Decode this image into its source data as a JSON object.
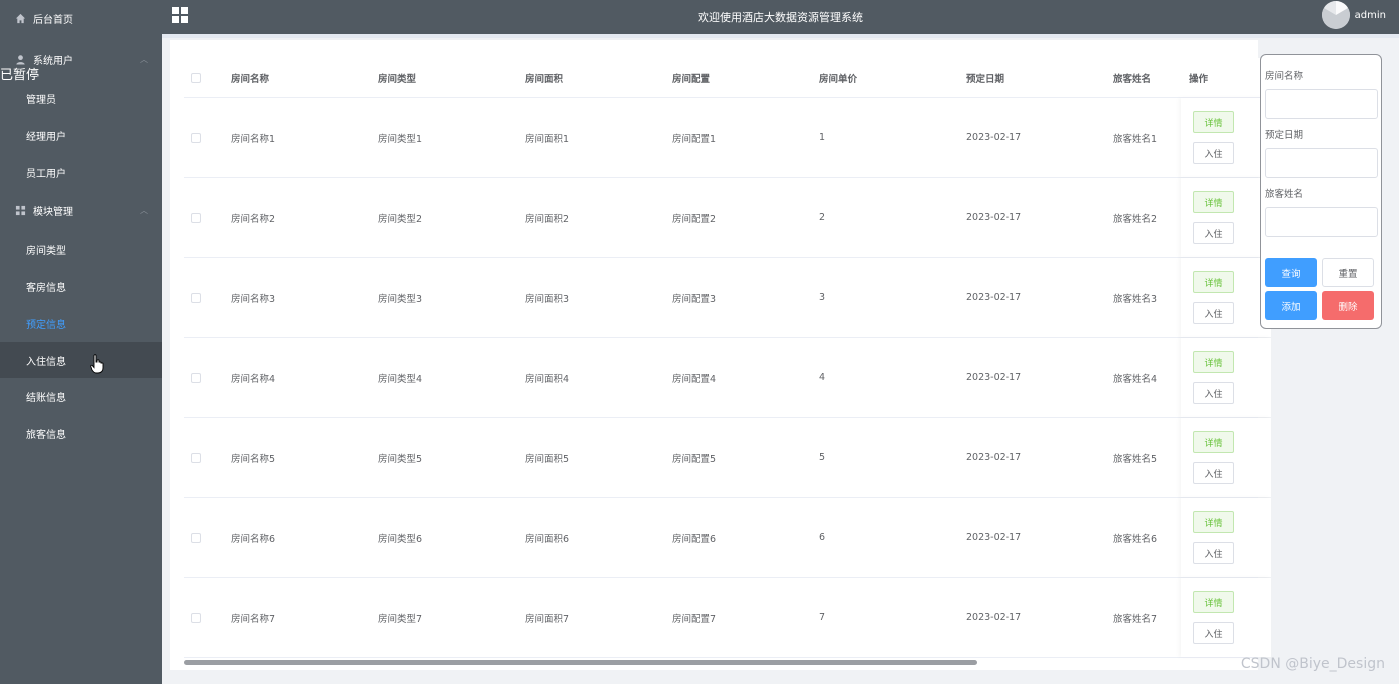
{
  "sidebar": {
    "paused_overlay": "已暂停",
    "items": [
      {
        "label": "后台首页",
        "icon": "home-icon"
      },
      {
        "label": "系统用户",
        "icon": "user-icon"
      },
      {
        "label": "管理员"
      },
      {
        "label": "经理用户"
      },
      {
        "label": "员工用户"
      },
      {
        "label": "模块管理",
        "icon": "grid-icon"
      },
      {
        "label": "房间类型"
      },
      {
        "label": "客房信息"
      },
      {
        "label": "预定信息"
      },
      {
        "label": "入住信息"
      },
      {
        "label": "结账信息"
      },
      {
        "label": "旅客信息"
      }
    ]
  },
  "header": {
    "title": "欢迎使用酒店大数据资源管理系统",
    "user": "admin"
  },
  "table": {
    "columns": [
      "房间名称",
      "房间类型",
      "房间面积",
      "房间配置",
      "房间单价",
      "预定日期",
      "旅客姓名",
      "操作"
    ],
    "rows": [
      [
        "房间名称1",
        "房间类型1",
        "房间面积1",
        "房间配置1",
        "1",
        "2023-02-17",
        "旅客姓名1"
      ],
      [
        "房间名称2",
        "房间类型2",
        "房间面积2",
        "房间配置2",
        "2",
        "2023-02-17",
        "旅客姓名2"
      ],
      [
        "房间名称3",
        "房间类型3",
        "房间面积3",
        "房间配置3",
        "3",
        "2023-02-17",
        "旅客姓名3"
      ],
      [
        "房间名称4",
        "房间类型4",
        "房间面积4",
        "房间配置4",
        "4",
        "2023-02-17",
        "旅客姓名4"
      ],
      [
        "房间名称5",
        "房间类型5",
        "房间面积5",
        "房间配置5",
        "5",
        "2023-02-17",
        "旅客姓名5"
      ],
      [
        "房间名称6",
        "房间类型6",
        "房间面积6",
        "房间配置6",
        "6",
        "2023-02-17",
        "旅客姓名6"
      ],
      [
        "房间名称7",
        "房间类型7",
        "房间面积7",
        "房间配置7",
        "7",
        "2023-02-17",
        "旅客姓名7"
      ]
    ],
    "detail_label": "详情",
    "checkin_label": "入住"
  },
  "search": {
    "room_name_label": "房间名称",
    "date_label": "预定日期",
    "guest_label": "旅客姓名",
    "query": "查询",
    "reset": "重置",
    "add": "添加",
    "delete": "删除"
  },
  "watermark": "CSDN @Biye_Design",
  "colors": {
    "sidebar_bg": "#515a62",
    "active": "#409eff",
    "danger": "#f56c6c",
    "success": "#67c23a"
  }
}
